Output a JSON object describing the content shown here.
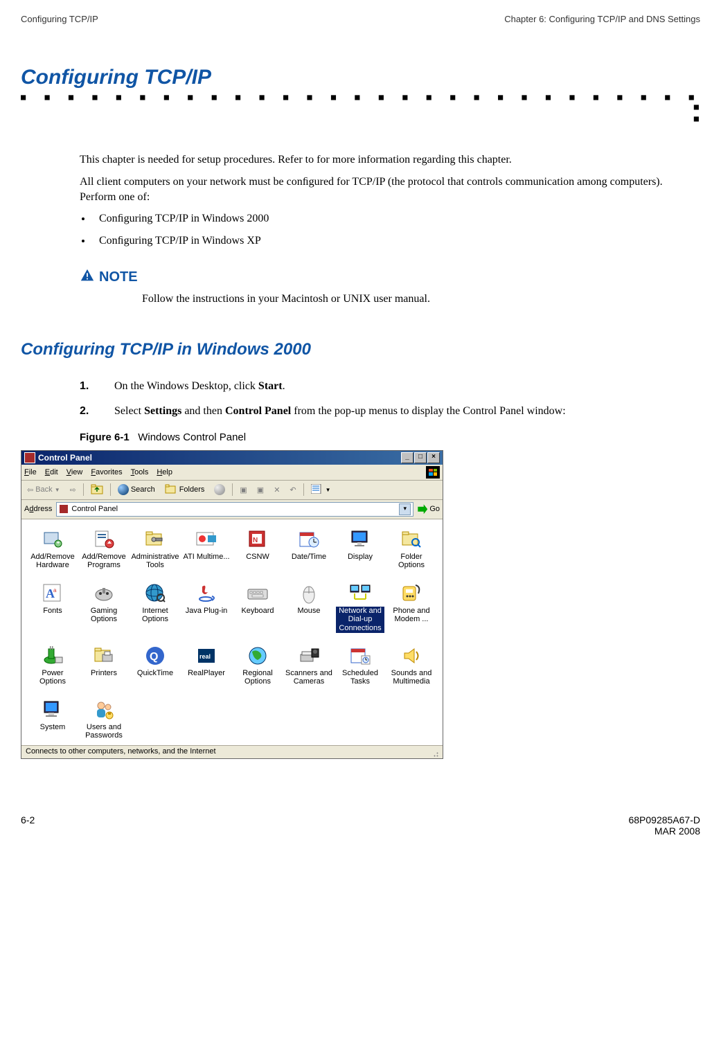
{
  "header": {
    "left": "Conﬁguring TCP/IP",
    "right": "Chapter 6: Conﬁguring TCP/IP and DNS Settings"
  },
  "h1": "Conﬁguring TCP/IP",
  "intro_p1": "This chapter is needed for setup procedures. Refer to for more information regarding this chapter.",
  "intro_p2": "All client computers on your network must be conﬁgured for TCP/IP (the protocol that controls communication among computers). Perform one of:",
  "bullets": [
    "Conﬁguring TCP/IP in Windows 2000",
    "Conﬁguring TCP/IP in Windows XP"
  ],
  "note_label": "NOTE",
  "note_text": "Follow the instructions in your Macintosh or UNIX user manual.",
  "h2": "Conﬁguring TCP/IP in Windows 2000",
  "steps": [
    {
      "num": "1.",
      "pre": "On the Windows Desktop, click ",
      "b1": "Start",
      "mid": ".",
      "b2": "",
      "post": ""
    },
    {
      "num": "2.",
      "pre": "Select ",
      "b1": "Settings",
      "mid": " and then ",
      "b2": "Control Panel",
      "post": " from the pop-up menus to display the Control Panel window:"
    }
  ],
  "figure": {
    "num": "Figure 6-1",
    "caption": "Windows Control Panel"
  },
  "cp": {
    "title": "Control Panel",
    "title_btns": [
      "_",
      "□",
      "×"
    ],
    "menu": [
      "File",
      "Edit",
      "View",
      "Favorites",
      "Tools",
      "Help"
    ],
    "toolbar": {
      "back": "Back",
      "search": "Search",
      "folders": "Folders"
    },
    "address_label": "Address",
    "address_value": "Control Panel",
    "go": "Go",
    "items": [
      {
        "label": "Add/Remove Hardware",
        "icon": "hw",
        "sel": false
      },
      {
        "label": "Add/Remove Programs",
        "icon": "prog",
        "sel": false
      },
      {
        "label": "Administrative Tools",
        "icon": "admin",
        "sel": false
      },
      {
        "label": "ATI Multime...",
        "icon": "ati",
        "sel": false
      },
      {
        "label": "CSNW",
        "icon": "csnw",
        "sel": false
      },
      {
        "label": "Date/Time",
        "icon": "datetime",
        "sel": false
      },
      {
        "label": "Display",
        "icon": "display",
        "sel": false
      },
      {
        "label": "Folder Options",
        "icon": "folder",
        "sel": false
      },
      {
        "label": "Fonts",
        "icon": "fonts",
        "sel": false
      },
      {
        "label": "Gaming Options",
        "icon": "gaming",
        "sel": false
      },
      {
        "label": "Internet Options",
        "icon": "inet",
        "sel": false
      },
      {
        "label": "Java Plug-in",
        "icon": "java",
        "sel": false
      },
      {
        "label": "Keyboard",
        "icon": "keyboard",
        "sel": false
      },
      {
        "label": "Mouse",
        "icon": "mouse",
        "sel": false
      },
      {
        "label": "Network and Dial-up Connections",
        "icon": "network",
        "sel": true
      },
      {
        "label": "Phone and Modem ...",
        "icon": "phone",
        "sel": false
      },
      {
        "label": "Power Options",
        "icon": "power",
        "sel": false
      },
      {
        "label": "Printers",
        "icon": "printers",
        "sel": false
      },
      {
        "label": "QuickTime",
        "icon": "qt",
        "sel": false
      },
      {
        "label": "RealPlayer",
        "icon": "real",
        "sel": false
      },
      {
        "label": "Regional Options",
        "icon": "regional",
        "sel": false
      },
      {
        "label": "Scanners and Cameras",
        "icon": "scanner",
        "sel": false
      },
      {
        "label": "Scheduled Tasks",
        "icon": "tasks",
        "sel": false
      },
      {
        "label": "Sounds and Multimedia",
        "icon": "sounds",
        "sel": false
      },
      {
        "label": "System",
        "icon": "system",
        "sel": false
      },
      {
        "label": "Users and Passwords",
        "icon": "users",
        "sel": false
      }
    ],
    "status": "Connects to other computers, networks, and the Internet"
  },
  "footer": {
    "left": "6-2",
    "right1": "68P09285A67-D",
    "right2": "MAR 2008"
  }
}
